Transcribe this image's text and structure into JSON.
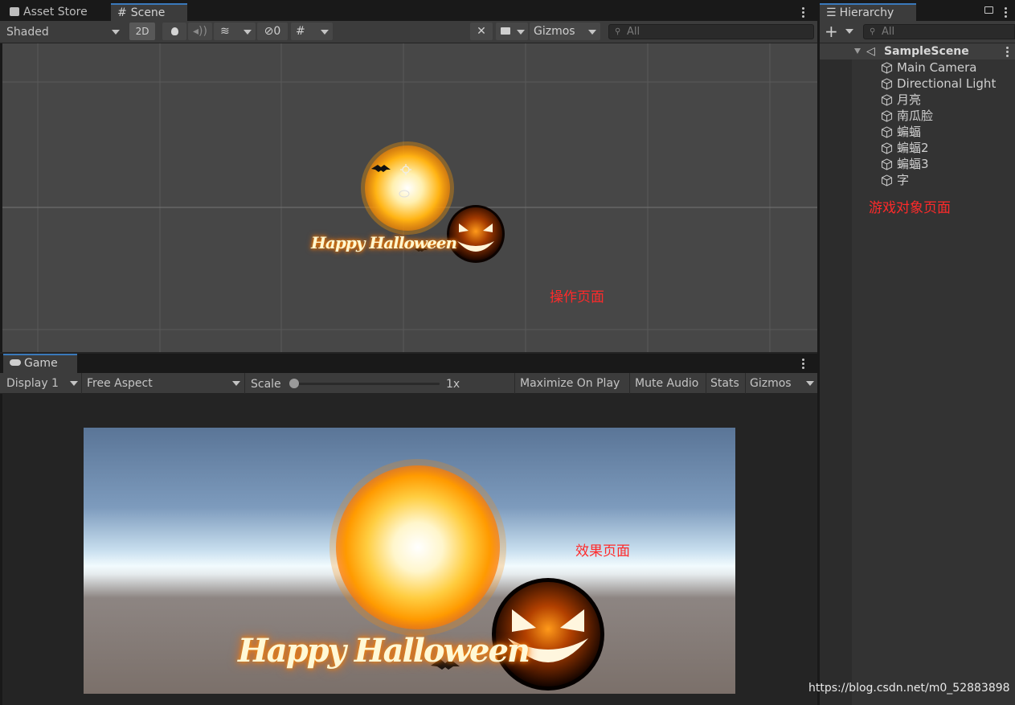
{
  "tabs": {
    "asset_store": "Asset Store",
    "scene": "Scene",
    "game": "Game",
    "hierarchy": "Hierarchy"
  },
  "scene_toolbar": {
    "shading_mode": "Shaded",
    "mode_2d": "2D",
    "hidden_count": "0",
    "gizmos": "Gizmos",
    "search_placeholder": "All"
  },
  "scene_view": {
    "annotation": "操作页面",
    "sprite_text": "Happy Halloween"
  },
  "game_toolbar": {
    "display": "Display 1",
    "aspect": "Free Aspect",
    "scale_label": "Scale",
    "scale_value": "1x",
    "maximize": "Maximize On Play",
    "mute": "Mute Audio",
    "stats": "Stats",
    "gizmos": "Gizmos"
  },
  "game_view": {
    "annotation": "效果页面",
    "sprite_text": "Happy Halloween"
  },
  "hierarchy": {
    "search_placeholder": "All",
    "scene_name": "SampleScene",
    "items": [
      {
        "label": "Main Camera"
      },
      {
        "label": "Directional Light"
      },
      {
        "label": "月亮"
      },
      {
        "label": "南瓜脸"
      },
      {
        "label": "蝙蝠"
      },
      {
        "label": "蝙蝠2"
      },
      {
        "label": "蝙蝠3"
      },
      {
        "label": "字"
      }
    ],
    "annotation": "游戏对象页面"
  },
  "watermark": "https://blog.csdn.net/m0_52883898",
  "colors": {
    "accent": "#3a79bb",
    "annotation": "#ff2a2a",
    "panel": "#3c3c3c",
    "scene_bg": "#474747"
  }
}
